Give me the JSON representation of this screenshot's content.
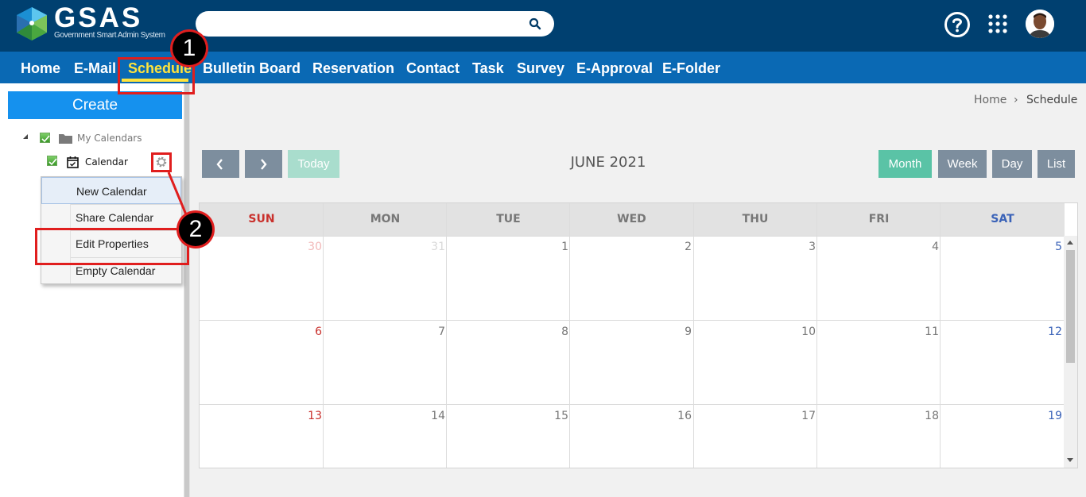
{
  "header": {
    "logo_text": "GSAS",
    "logo_subtitle": "Government Smart Admin System",
    "search_placeholder": ""
  },
  "nav": {
    "items": [
      "Home",
      "E-Mail",
      "Schedule",
      "Bulletin Board",
      "Reservation",
      "Contact",
      "Task",
      "Survey",
      "E-Approval",
      "E-Folder"
    ],
    "active": "Schedule"
  },
  "sidebar": {
    "create_label": "Create",
    "group_label": "My Calendars",
    "calendar_label": "Calendar",
    "context_menu": [
      "New Calendar",
      "Share Calendar",
      "Edit Properties",
      "Empty Calendar"
    ]
  },
  "breadcrumb": {
    "home": "Home",
    "separator": "›",
    "current": "Schedule"
  },
  "toolbar": {
    "prev_icon": "chevron-left-icon",
    "next_icon": "chevron-right-icon",
    "today_label": "Today",
    "title": "JUNE 2021",
    "views": [
      "Month",
      "Week",
      "Day",
      "List"
    ],
    "active_view": "Month"
  },
  "calendar": {
    "days_of_week": [
      "SUN",
      "MON",
      "TUE",
      "WED",
      "THU",
      "FRI",
      "SAT"
    ],
    "weeks": [
      [
        "30",
        "31",
        "1",
        "2",
        "3",
        "4",
        "5"
      ],
      [
        "6",
        "7",
        "8",
        "9",
        "10",
        "11",
        "12"
      ],
      [
        "13",
        "14",
        "15",
        "16",
        "17",
        "18",
        "19"
      ]
    ]
  },
  "annotations": {
    "step1": "1",
    "step2": "2"
  },
  "colors": {
    "header_bg": "#004070",
    "nav_bg": "#0a69b4",
    "active_nav": "#ffe33c",
    "create_btn": "#1591ee",
    "view_active": "#5ac3a6",
    "view_btn": "#7d8e9e",
    "callout": "#e01e1e",
    "sunday": "#c9302c",
    "saturday": "#3b63b8"
  }
}
